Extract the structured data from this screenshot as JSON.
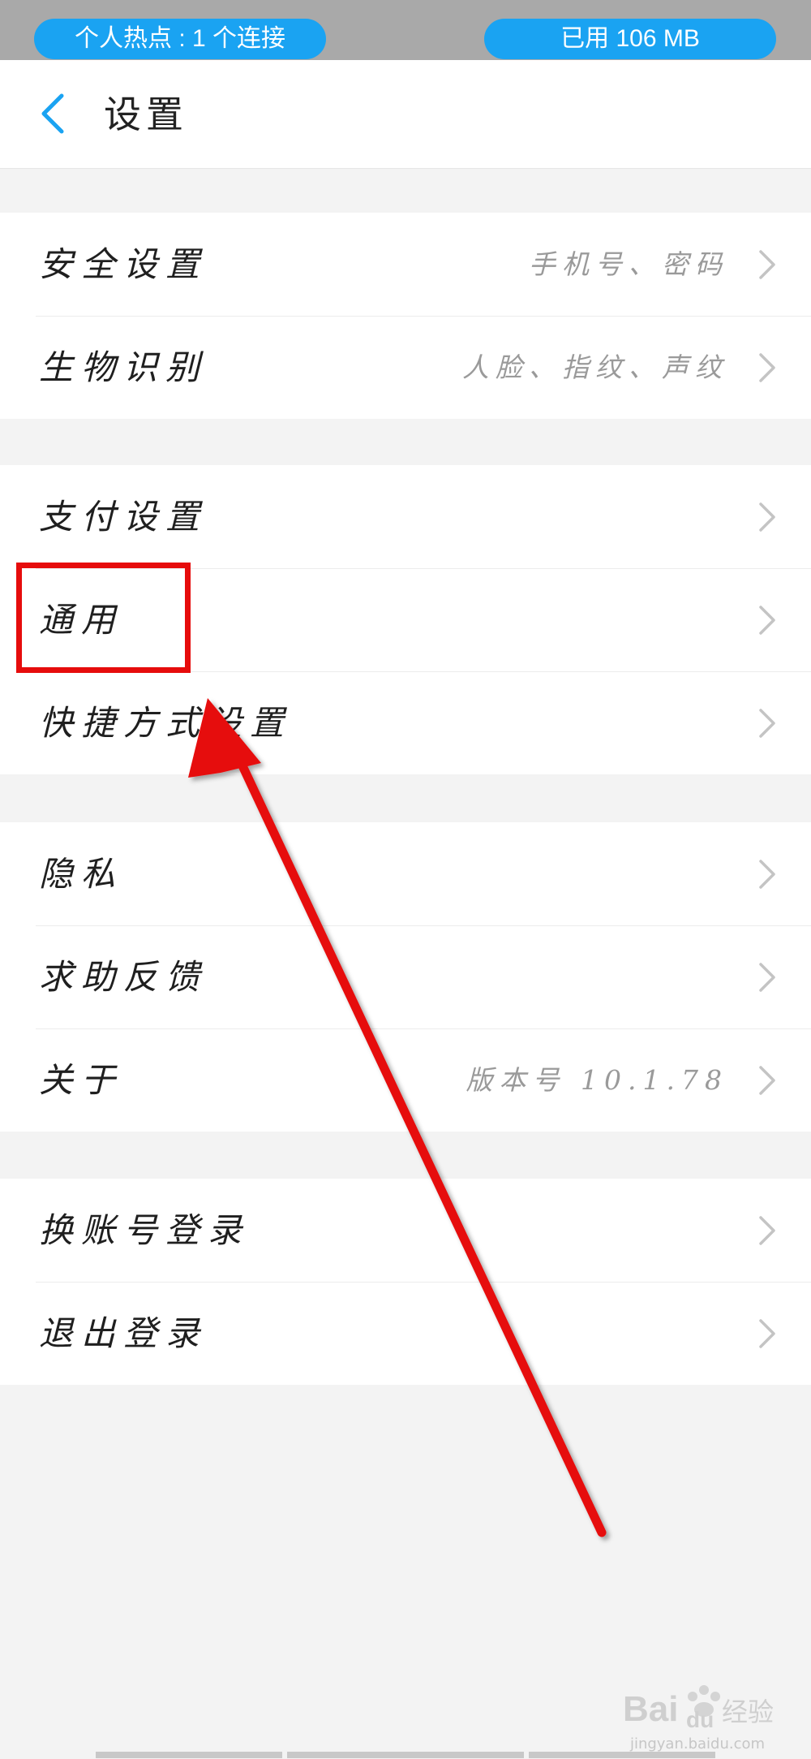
{
  "status_bar": {
    "hotspot": "个人热点 : 1 个连接",
    "data_used": "已用 106 MB"
  },
  "header": {
    "title": "设置",
    "back_icon": "chevron-left-icon"
  },
  "groups": [
    {
      "rows": [
        {
          "label": "安全设置",
          "value": "手机号、密码"
        },
        {
          "label": "生物识别",
          "value": "人脸、指纹、声纹"
        }
      ]
    },
    {
      "rows": [
        {
          "label": "支付设置",
          "value": ""
        },
        {
          "label": "通用",
          "value": ""
        },
        {
          "label": "快捷方式设置",
          "value": ""
        }
      ]
    },
    {
      "rows": [
        {
          "label": "隐私",
          "value": ""
        },
        {
          "label": "求助反馈",
          "value": ""
        },
        {
          "label": "关于",
          "value": "版本号 10.1.78"
        }
      ]
    },
    {
      "rows": [
        {
          "label": "换账号登录",
          "value": ""
        },
        {
          "label": "退出登录",
          "value": ""
        }
      ]
    }
  ],
  "watermark": {
    "logo": "Baidu经验",
    "url": "jingyan.baidu.com"
  },
  "colors": {
    "accent": "#1aa3f2",
    "annotation": "#e60c0c"
  }
}
